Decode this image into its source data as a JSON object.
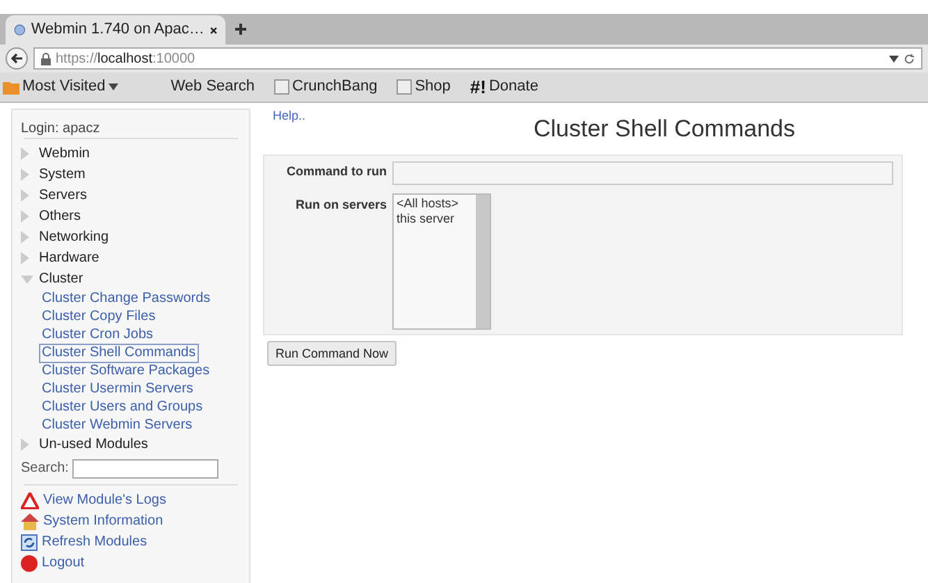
{
  "browser": {
    "tab_title": "Webmin 1.740 on Apac…",
    "url_scheme": "https://",
    "url_host": "localhost",
    "url_port": ":10000",
    "bookmarks": [
      {
        "label": "Most Visited",
        "kind": "folder"
      },
      {
        "label": "Web Search",
        "kind": "plain"
      },
      {
        "label": "CrunchBang",
        "kind": "page"
      },
      {
        "label": "Shop",
        "kind": "page"
      },
      {
        "label": "Donate",
        "kind": "hashbang",
        "icon_text": "#!"
      }
    ]
  },
  "sidebar": {
    "login": "Login: apacz",
    "categories": [
      {
        "label": "Webmin",
        "expanded": false
      },
      {
        "label": "System",
        "expanded": false
      },
      {
        "label": "Servers",
        "expanded": false
      },
      {
        "label": "Others",
        "expanded": false
      },
      {
        "label": "Networking",
        "expanded": false
      },
      {
        "label": "Hardware",
        "expanded": false
      },
      {
        "label": "Cluster",
        "expanded": true,
        "children": [
          {
            "label": "Cluster Change Passwords",
            "selected": false
          },
          {
            "label": "Cluster Copy Files",
            "selected": false
          },
          {
            "label": "Cluster Cron Jobs",
            "selected": false
          },
          {
            "label": "Cluster Shell Commands",
            "selected": true
          },
          {
            "label": "Cluster Software Packages",
            "selected": false
          },
          {
            "label": "Cluster Usermin Servers",
            "selected": false
          },
          {
            "label": "Cluster Users and Groups",
            "selected": false
          },
          {
            "label": "Cluster Webmin Servers",
            "selected": false
          }
        ]
      },
      {
        "label": "Un-used Modules",
        "expanded": false
      }
    ],
    "search_label": "Search:",
    "links": [
      {
        "label": "View Module's Logs",
        "kind": "warning"
      },
      {
        "label": "System Information",
        "kind": "home"
      },
      {
        "label": "Refresh Modules",
        "kind": "refresh"
      },
      {
        "label": "Logout",
        "kind": "logout"
      }
    ]
  },
  "main": {
    "help": "Help..",
    "title": "Cluster Shell Commands",
    "command_label": "Command to run",
    "servers_label": "Run on servers",
    "servers": [
      {
        "label": "<All hosts>",
        "selected": false
      },
      {
        "label": "this server",
        "selected": false
      }
    ],
    "button": "Run Command Now"
  }
}
